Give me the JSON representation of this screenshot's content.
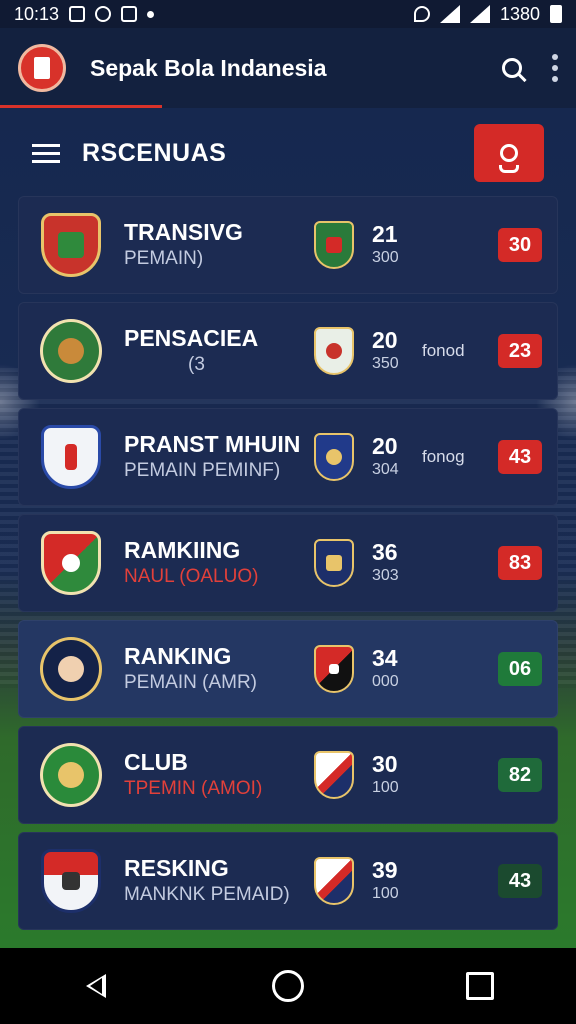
{
  "status_bar": {
    "time": "10:13",
    "battery_text": "1380"
  },
  "app_bar": {
    "title": "Sepak Bola Indanesia"
  },
  "section": {
    "title": "RSCENUAS"
  },
  "rows": [
    {
      "name": "TRANSIVG",
      "sub": "PEMAIN)",
      "score": "21",
      "score_sub": "300",
      "form": "",
      "badge": "30",
      "badge_color": "red",
      "highlight": false,
      "sub_red": false
    },
    {
      "name": "PENSACIEA",
      "sub": "(3",
      "score": "20",
      "score_sub": "350",
      "form": "fonod",
      "badge": "23",
      "badge_color": "red",
      "highlight": false,
      "sub_red": false
    },
    {
      "name": "PRANST MHUIN",
      "sub": "PEMAIN PEMINF)",
      "score": "20",
      "score_sub": "304",
      "form": "fonog",
      "badge": "43",
      "badge_color": "red",
      "highlight": false,
      "sub_red": false
    },
    {
      "name": "RAMKIING",
      "sub": "NAUL (OALUO)",
      "score": "36",
      "score_sub": "303",
      "form": "",
      "badge": "83",
      "badge_color": "red",
      "highlight": false,
      "sub_red": true
    },
    {
      "name": "RANKING",
      "sub": "PEMAIN (AMR)",
      "score": "34",
      "score_sub": "000",
      "form": "",
      "badge": "06",
      "badge_color": "green",
      "highlight": true,
      "sub_red": false
    },
    {
      "name": "CLUB",
      "sub": "TPEMIN (AMOI)",
      "score": "30",
      "score_sub": "100",
      "form": "",
      "badge": "82",
      "badge_color": "green",
      "highlight": false,
      "sub_red": true
    },
    {
      "name": "RESKING",
      "sub": "MANKNK PEMAID)",
      "score": "39",
      "score_sub": "100",
      "form": "",
      "badge": "43",
      "badge_color": "darkgreen",
      "highlight": false,
      "sub_red": false
    }
  ],
  "icons": {
    "search": "search-icon",
    "more": "more-vert-icon",
    "menu": "hamburger-icon",
    "user": "user-icon",
    "back": "back-icon",
    "home": "home-icon",
    "recent": "recent-apps-icon"
  },
  "colors": {
    "accent": "#d42a27",
    "green": "#1f7a3a",
    "background": "#0f1c3a"
  }
}
